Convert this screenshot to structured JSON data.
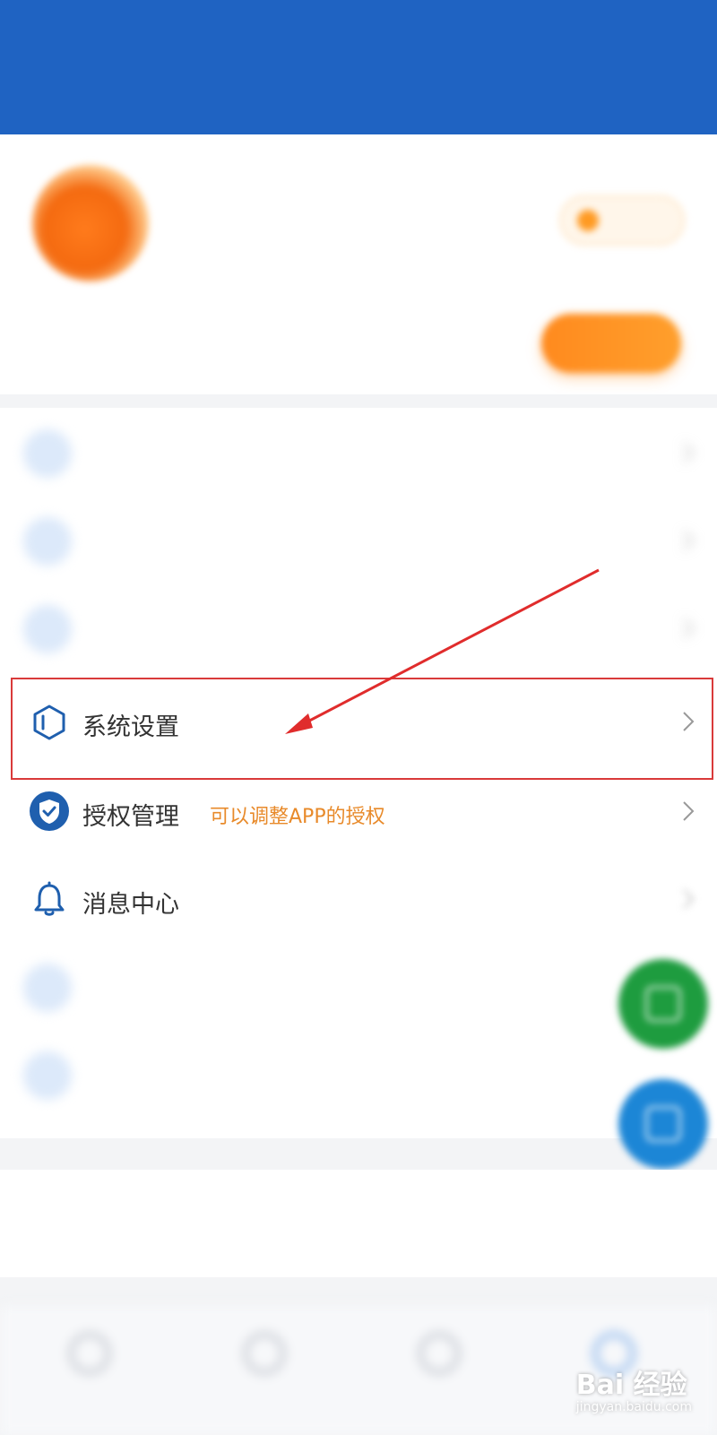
{
  "status_bar": {
    "left_text": "",
    "right_text": ""
  },
  "header": {
    "title": "",
    "color": "#1f63c2"
  },
  "profile": {
    "name": "",
    "sub_info": "",
    "vip_label": "",
    "promo_text": "",
    "promo_button": ""
  },
  "menu": {
    "items": [
      {
        "label": "",
        "note": "",
        "icon": "document-icon"
      },
      {
        "label": "",
        "icon": "user-icon"
      },
      {
        "label": "",
        "icon": "link-icon"
      },
      {
        "label": "系统设置",
        "icon": "hexagon-icon"
      },
      {
        "label": "授权管理",
        "note": "可以调整APP的授权",
        "icon": "shield-check-icon"
      },
      {
        "label": "消息中心",
        "icon": "bell-icon"
      },
      {
        "label": "",
        "note": "",
        "icon": "clock-icon"
      },
      {
        "label": "",
        "icon": "phone-icon"
      }
    ]
  },
  "logout_text": "",
  "bottom_nav": [
    {
      "label": ""
    },
    {
      "label": ""
    },
    {
      "label": ""
    },
    {
      "label": ""
    }
  ],
  "watermark": {
    "brand": "Bai 经验",
    "url": "jingyan.baidu.com"
  },
  "colors": {
    "accent": "#1f63c2",
    "note_orange": "#e88a2a",
    "highlight_red": "#d93a3a"
  }
}
